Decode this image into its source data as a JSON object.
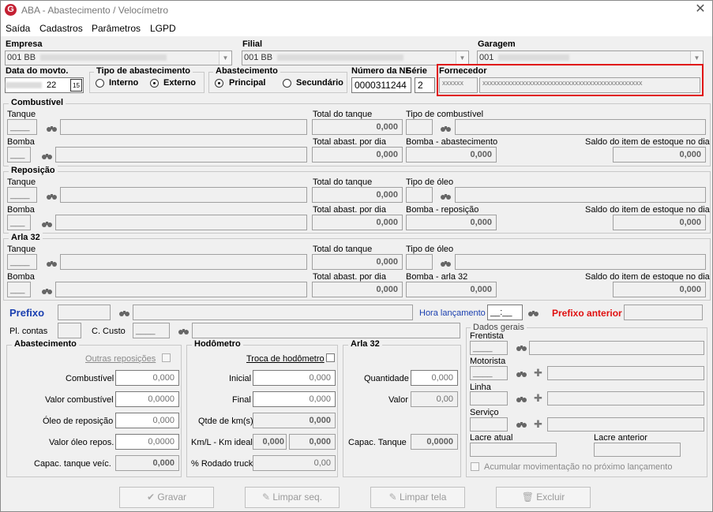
{
  "window": {
    "title": "ABA - Abastecimento / Velocímetro",
    "icon_letter": "G",
    "close_glyph": "✕"
  },
  "menu": [
    "Saída",
    "Cadastros",
    "Parâmetros",
    "LGPD"
  ],
  "header": {
    "empresa_label": "Empresa",
    "empresa_value": "001 BB",
    "filial_label": "Filial",
    "filial_value": "001 BB",
    "garagem_label": "Garagem",
    "garagem_value": "001",
    "data_label": "Data do movto.",
    "data_value": "22",
    "calendar_glyph": "15",
    "tipo_label": "Tipo de abastecimento",
    "tipo_interno": "Interno",
    "tipo_externo": "Externo",
    "abast_label": "Abastecimento",
    "abast_principal": "Principal",
    "abast_secundario": "Secundário",
    "nf_label": "Número da NF",
    "nf_value": "0000311244",
    "serie_label": "Série",
    "serie_value": "2",
    "fornecedor_label": "Fornecedor",
    "fornecedor_code": "xxxxxx",
    "fornecedor_name": "xxxxxxxxxxxxxxxxxxxxxxxxxxxxxxxxxxxxxxxxxxxxx"
  },
  "sections": [
    {
      "title": "Combustível",
      "tanque": "Tanque",
      "total_tanque": "Total do tanque",
      "total_tanque_value": "0,000",
      "tipo": "Tipo de combustível",
      "bomba": "Bomba",
      "total_dia": "Total abast. por dia",
      "total_dia_value": "0,000",
      "bomba_x": "Bomba - abastecimento",
      "bomba_x_value": "0,000",
      "saldo": "Saldo do item de estoque no dia",
      "saldo_value": "0,000"
    },
    {
      "title": "Reposição",
      "tanque": "Tanque",
      "total_tanque": "Total do tanque",
      "total_tanque_value": "0,000",
      "tipo": "Tipo de óleo",
      "bomba": "Bomba",
      "total_dia": "Total abast. por dia",
      "total_dia_value": "0,000",
      "bomba_x": "Bomba - reposição",
      "bomba_x_value": "0,000",
      "saldo": "Saldo do item de estoque no dia",
      "saldo_value": "0,000"
    },
    {
      "title": "Arla 32",
      "tanque": "Tanque",
      "total_tanque": "Total do tanque",
      "total_tanque_value": "0,000",
      "tipo": "Tipo de óleo",
      "bomba": "Bomba",
      "total_dia": "Total abast. por dia",
      "total_dia_value": "0,000",
      "bomba_x": "Bomba - arla 32",
      "bomba_x_value": "0,000",
      "saldo": "Saldo do item de estoque no dia",
      "saldo_value": "0,000"
    }
  ],
  "prefixo": {
    "label": "Prefixo",
    "hora_label": "Hora lançamento",
    "hora_value": "__:__",
    "anterior_label": "Prefixo anterior",
    "pl_contas": "Pl. contas",
    "c_custo": "C. Custo",
    "c_custo_value": "____"
  },
  "abastecimento": {
    "title": "Abastecimento",
    "outras": "Outras reposições",
    "combustivel": "Combustível",
    "combustivel_value": "0,000",
    "valor_comb": "Valor combustível",
    "valor_comb_value": "0,0000",
    "oleo": "Óleo de reposição",
    "oleo_value": "0,000",
    "valor_oleo": "Valor óleo repos.",
    "valor_oleo_value": "0,0000",
    "capac": "Capac. tanque veíc.",
    "capac_value": "0,000"
  },
  "hodometro": {
    "title": "Hodômetro",
    "troca": "Troca de hodômetro",
    "inicial": "Inicial",
    "inicial_value": "0,000",
    "final": "Final",
    "final_value": "0,000",
    "qtde": "Qtde de km(s)",
    "qtde_value": "0,000",
    "kml": "Km/L - Km ideal",
    "kml_value": "0,000",
    "ideal_value": "0,000",
    "rodado": "% Rodado truck",
    "rodado_value": "0,00"
  },
  "arla": {
    "title": "Arla 32",
    "quantidade": "Quantidade",
    "quantidade_value": "0,000",
    "valor": "Valor",
    "valor_value": "0,00",
    "capac": "Capac. Tanque",
    "capac_value": "0,0000"
  },
  "dados": {
    "title": "Dados gerais",
    "frentista": "Frentista",
    "motorista": "Motorista",
    "linha": "Linha",
    "servico": "Serviço",
    "lacre_atual": "Lacre atual",
    "lacre_anterior": "Lacre anterior",
    "acumular": "Acumular movimentação no próximo lançamento"
  },
  "buttons": {
    "gravar": "Gravar",
    "limpar_seq": "Limpar seq.",
    "limpar_tela": "Limpar tela",
    "excluir": "Excluir"
  },
  "colors": {
    "accent_blue": "#1a3fb0",
    "accent_red": "#e01010",
    "brand": "#c42033"
  }
}
